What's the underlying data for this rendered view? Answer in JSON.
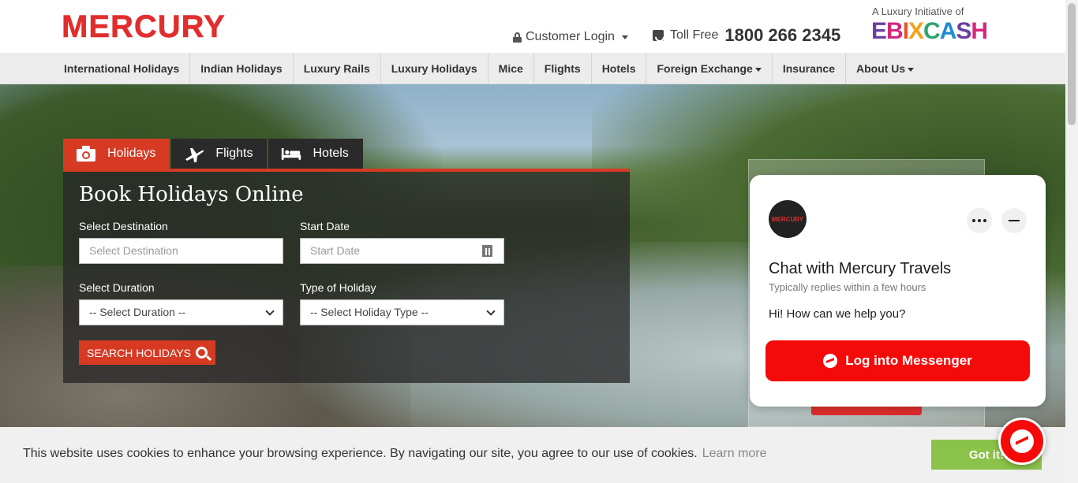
{
  "header": {
    "logo": "MERCURY",
    "customer_login": "Customer Login",
    "toll_label": "Toll Free",
    "toll_number": "1800 266 2345",
    "luxury_text": "A Luxury Initiative of",
    "partner_logo": "EBIXCASH"
  },
  "nav": {
    "items": [
      "International Holidays",
      "Indian Holidays",
      "Luxury Rails",
      "Luxury Holidays",
      "Mice",
      "Flights",
      "Hotels",
      "Foreign Exchange",
      "Insurance",
      "About Us"
    ]
  },
  "booking": {
    "tabs": [
      "Holidays",
      "Flights",
      "Hotels"
    ],
    "active_tab": "Holidays",
    "title": "Book Holidays Online",
    "destination_label": "Select Destination",
    "destination_placeholder": "Select Destination",
    "start_date_label": "Start Date",
    "start_date_placeholder": "Start Date",
    "duration_label": "Select Duration",
    "duration_value": "-- Select Duration --",
    "type_label": "Type of Holiday",
    "type_value": "-- Select Holiday Type --",
    "search_button": "SEARCH HOLIDAYS"
  },
  "chat": {
    "avatar_text": "MERCURY",
    "title": "Chat with Mercury Travels",
    "subtitle": "Typically replies within a few hours",
    "message": "Hi! How can we help you?",
    "button": "Log into Messenger"
  },
  "cookie": {
    "text": "This website uses cookies to enhance your browsing experience. By navigating our site, you agree to our use of cookies.",
    "link": "Learn more",
    "button": "Got it!"
  },
  "colors": {
    "brand_red": "#e12d2d",
    "tab_red": "#d63a23",
    "messenger_red": "#f50a0a",
    "cookie_green": "#8bc34a"
  }
}
